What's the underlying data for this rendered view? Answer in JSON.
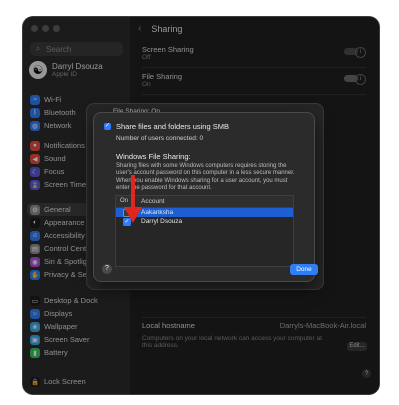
{
  "window": {
    "title": "Sharing"
  },
  "sidebar": {
    "search_placeholder": "Search",
    "user": {
      "name": "Darryl Dsouza",
      "sub": "Apple ID"
    },
    "items": [
      {
        "label": "Wi-Fi",
        "color": "#2f7ef6",
        "icon": "wifi-icon",
        "glyph": "≈"
      },
      {
        "label": "Bluetooth",
        "color": "#2f7ef6",
        "icon": "bluetooth-icon",
        "glyph": "ᛒ"
      },
      {
        "label": "Network",
        "color": "#2f7ef6",
        "icon": "globe-icon",
        "glyph": "◍"
      },
      {
        "label": "Notifications",
        "color": "#e34a3c",
        "icon": "bell-icon",
        "glyph": "●"
      },
      {
        "label": "Sound",
        "color": "#e34a3c",
        "icon": "speaker-icon",
        "glyph": "◀"
      },
      {
        "label": "Focus",
        "color": "#5b57d8",
        "icon": "moon-icon",
        "glyph": "☾"
      },
      {
        "label": "Screen Time",
        "color": "#5b57d8",
        "icon": "hourglass-icon",
        "glyph": "⌛"
      },
      {
        "label": "General",
        "color": "#8e8e93",
        "icon": "gear-icon",
        "glyph": "⚙"
      },
      {
        "label": "Appearance",
        "color": "#1c1c1e",
        "icon": "appearance-icon",
        "glyph": "◐"
      },
      {
        "label": "Accessibility",
        "color": "#2f7ef6",
        "icon": "accessibility-icon",
        "glyph": "☺"
      },
      {
        "label": "Control Cent",
        "color": "#8e8e93",
        "icon": "control-center-icon",
        "glyph": "▤"
      },
      {
        "label": "Siri & Spotlig",
        "color": "#b051d6",
        "icon": "siri-icon",
        "glyph": "◉"
      },
      {
        "label": "Privacy & Se",
        "color": "#2f7ef6",
        "icon": "hand-icon",
        "glyph": "✋"
      },
      {
        "label": "Desktop & Dock",
        "color": "#1c1c1e",
        "icon": "dock-icon",
        "glyph": "▭"
      },
      {
        "label": "Displays",
        "color": "#2f7ef6",
        "icon": "sun-icon",
        "glyph": "☼"
      },
      {
        "label": "Wallpaper",
        "color": "#3aa6e8",
        "icon": "wallpaper-icon",
        "glyph": "❀"
      },
      {
        "label": "Screen Saver",
        "color": "#3aa6e8",
        "icon": "screensaver-icon",
        "glyph": "▣"
      },
      {
        "label": "Battery",
        "color": "#34c759",
        "icon": "battery-icon",
        "glyph": "▮"
      },
      {
        "label": "Lock Screen",
        "color": "#1c1c1e",
        "icon": "lock-icon",
        "glyph": "🔒"
      }
    ]
  },
  "main": {
    "rows": [
      {
        "label": "Screen Sharing",
        "sub": "Off"
      },
      {
        "label": "File Sharing",
        "sub": "On"
      }
    ],
    "partial_behind": "File Sharing: On",
    "hostname_label": "Local hostname",
    "hostname_value": "Darryls-MacBook-Air.local",
    "footer_text": "Computers on your local network can access your computer at this address.",
    "edit_label": "Edit..."
  },
  "dialog": {
    "smb_label": "Share files and folders using SMB",
    "users_connected": "Number of users connected: 0",
    "windows_header": "Windows File Sharing:",
    "description": "Sharing files with some Windows computers requires storing the user's account password on this computer in a less secure manner. When you enable Windows sharing for a user account, you must enter the password for that account.",
    "table": {
      "col_on": "On",
      "col_account": "Account",
      "rows": [
        {
          "name": "Aakanksha",
          "checked": false,
          "selected": true
        },
        {
          "name": "Darryl Dsouza",
          "checked": true,
          "selected": false
        }
      ]
    },
    "help_label": "?",
    "done_label": "Done"
  },
  "annotation": {
    "arrow_color": "#e0261f"
  }
}
